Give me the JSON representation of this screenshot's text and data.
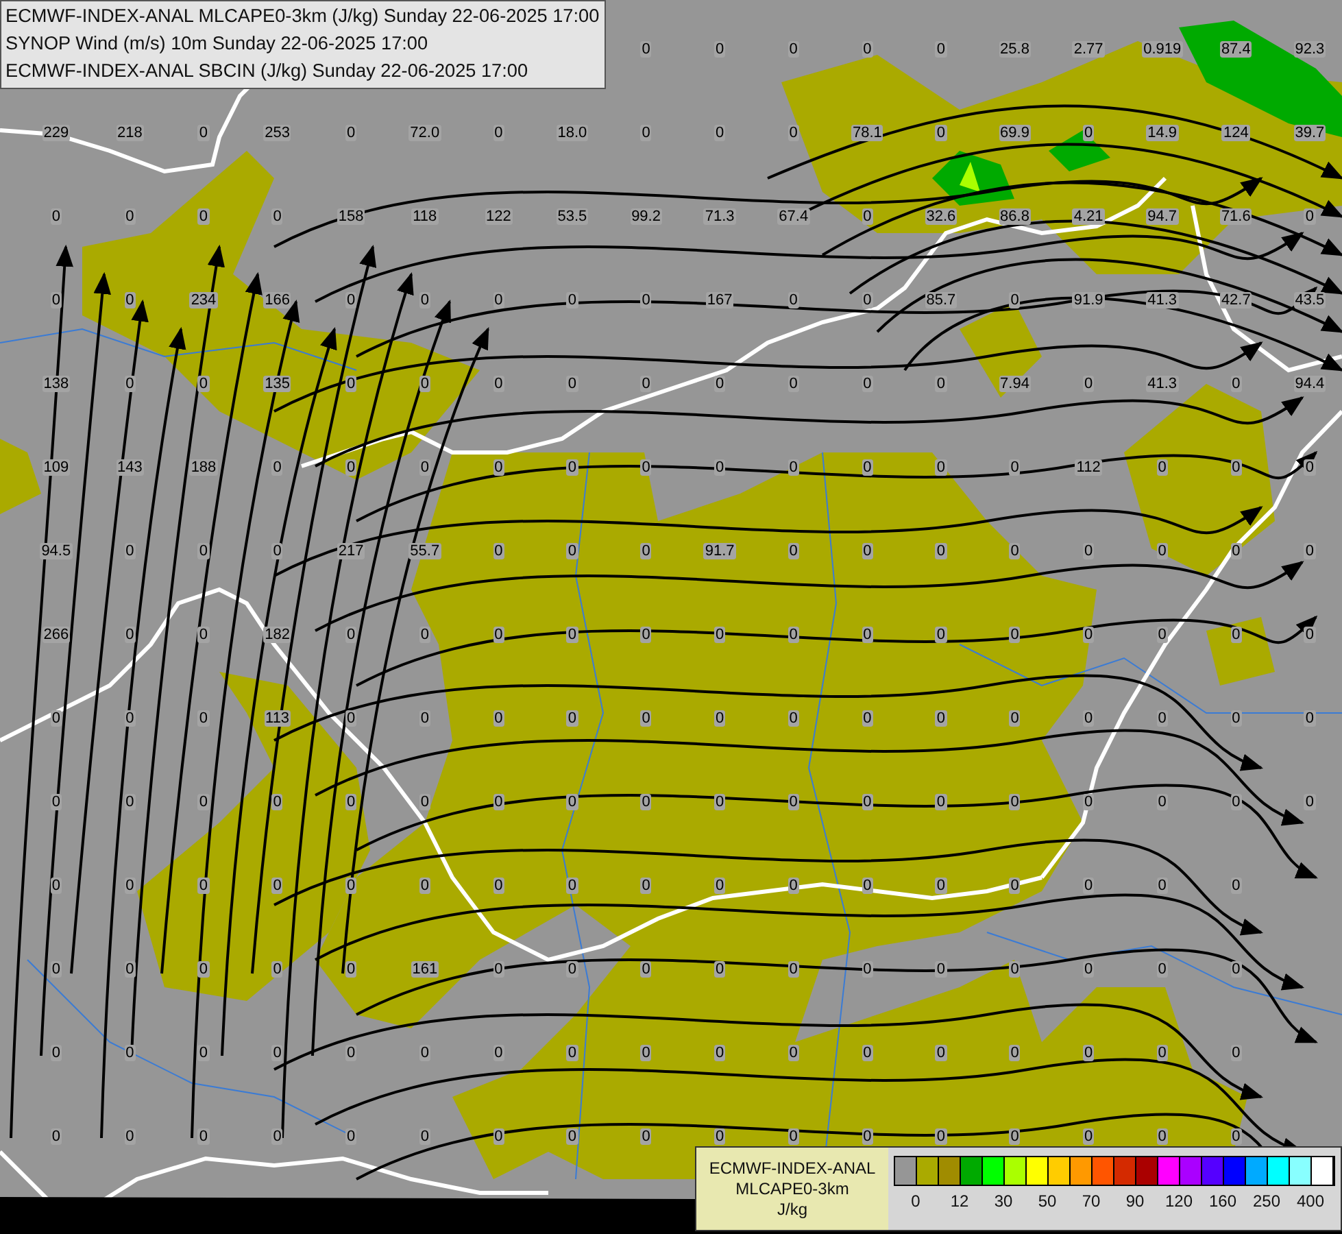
{
  "header": {
    "lines": [
      "ECMWF-INDEX-ANAL MLCAPE0-3km (J/kg) Sunday 22-06-2025 17:00",
      "SYNOP Wind (m/s) 10m Sunday 22-06-2025 17:00",
      "ECMWF-INDEX-ANAL SBCIN (J/kg) Sunday 22-06-2025 17:00"
    ]
  },
  "map": {
    "value_rows": [
      [
        null,
        null,
        null,
        null,
        null,
        null,
        null,
        null,
        "0",
        "0",
        "0",
        "0",
        "0",
        "25.8",
        "2.77",
        "0.919",
        "87.4",
        "92.3"
      ],
      [
        "229",
        "218",
        "0",
        "253",
        "0",
        "72.0",
        "0",
        "18.0",
        "0",
        "0",
        "0",
        "78.1",
        "0",
        "69.9",
        "0",
        "14.9",
        "124",
        "39.7"
      ],
      [
        "0",
        "0",
        "0",
        "0",
        "158",
        "118",
        "122",
        "53.5",
        "99.2",
        "71.3",
        "67.4",
        "0",
        "32.6",
        "86.8",
        "4.21",
        "94.7",
        "71.6",
        "0"
      ],
      [
        "0",
        "0",
        "234",
        "166",
        "0",
        "0",
        "0",
        "0",
        "0",
        "167",
        "0",
        "0",
        "85.7",
        "0",
        "91.9",
        "41.3",
        "42.7",
        "43.5"
      ],
      [
        "138",
        "0",
        "0",
        "135",
        "0",
        "0",
        "0",
        "0",
        "0",
        "0",
        "0",
        "0",
        "0",
        "7.94",
        "0",
        "41.3",
        "0",
        "94.4"
      ],
      [
        "109",
        "143",
        "188",
        "0",
        "0",
        "0",
        "0",
        "0",
        "0",
        "0",
        "0",
        "0",
        "0",
        "0",
        "112",
        "0",
        "0",
        "0"
      ],
      [
        "94.5",
        "0",
        "0",
        "0",
        "217",
        "55.7",
        "0",
        "0",
        "0",
        "91.7",
        "0",
        "0",
        "0",
        "0",
        "0",
        "0",
        "0",
        "0"
      ],
      [
        "266",
        "0",
        "0",
        "182",
        "0",
        "0",
        "0",
        "0",
        "0",
        "0",
        "0",
        "0",
        "0",
        "0",
        "0",
        "0",
        "0",
        "0"
      ],
      [
        "0",
        "0",
        "0",
        "113",
        "0",
        "0",
        "0",
        "0",
        "0",
        "0",
        "0",
        "0",
        "0",
        "0",
        "0",
        "0",
        "0",
        "0"
      ],
      [
        "0",
        "0",
        "0",
        "0",
        "0",
        "0",
        "0",
        "0",
        "0",
        "0",
        "0",
        "0",
        "0",
        "0",
        "0",
        "0",
        "0",
        "0"
      ],
      [
        "0",
        "0",
        "0",
        "0",
        "0",
        "0",
        "0",
        "0",
        "0",
        "0",
        "0",
        "0",
        "0",
        "0",
        "0",
        "0",
        "0",
        null
      ],
      [
        "0",
        "0",
        "0",
        "0",
        "0",
        "161",
        "0",
        "0",
        "0",
        "0",
        "0",
        "0",
        "0",
        "0",
        "0",
        "0",
        "0",
        null
      ],
      [
        "0",
        "0",
        "0",
        "0",
        "0",
        "0",
        "0",
        "0",
        "0",
        "0",
        "0",
        "0",
        "0",
        "0",
        "0",
        "0",
        "0",
        null
      ],
      [
        "0",
        "0",
        "0",
        "0",
        "0",
        "0",
        "0",
        "0",
        "0",
        "0",
        "0",
        "0",
        "0",
        "0",
        "0",
        "0",
        "0",
        null
      ]
    ]
  },
  "legend": {
    "title_lines": [
      "ECMWF-INDEX-ANAL",
      "MLCAPE0-3km"
    ],
    "unit": "J/kg",
    "swatches": [
      {
        "color": "#969696"
      },
      {
        "color": "#aaaa00"
      },
      {
        "color": "#a08c00"
      },
      {
        "color": "#00aa00"
      },
      {
        "color": "#00ff00"
      },
      {
        "color": "#aaff00"
      },
      {
        "color": "#ffff00"
      },
      {
        "color": "#ffcc00"
      },
      {
        "color": "#ff9900"
      },
      {
        "color": "#ff5500"
      },
      {
        "color": "#d42a00"
      },
      {
        "color": "#aa0000"
      },
      {
        "color": "#ff00ff"
      },
      {
        "color": "#aa00ff"
      },
      {
        "color": "#5500ff"
      },
      {
        "color": "#0000ff"
      },
      {
        "color": "#00aaff"
      },
      {
        "color": "#00ffff"
      },
      {
        "color": "#88ffff"
      },
      {
        "color": "#ffffff"
      }
    ],
    "ticks": [
      "0",
      "12",
      "30",
      "50",
      "70",
      "90",
      "120",
      "160",
      "250",
      "400"
    ]
  }
}
